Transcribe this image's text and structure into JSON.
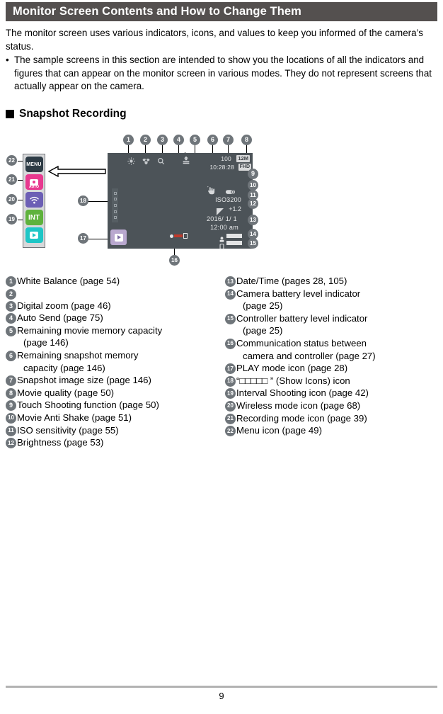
{
  "header": {
    "title": "Monitor Screen Contents and How to Change Them"
  },
  "intro": {
    "para1": "The monitor screen uses various indicators, icons, and values to keep you informed of the camera’s status.",
    "bullet_mark": "•",
    "bullet1": "The sample screens in this section are intended to show you the locations of all the indicators and figures that can appear on the monitor screen in various modes. They do not represent screens that actually appear on the camera."
  },
  "section": {
    "heading": "Snapshot Recording"
  },
  "monitor": {
    "remaining_snapshots": "100",
    "image_size_badge": "12M",
    "remaining_movie_time": "10:28:28",
    "movie_quality_badge": "FHD",
    "iso": "ISO3200",
    "brightness": "+1.2",
    "date": "2016/  1/  1",
    "clock": "12:00 am",
    "menu_label": "MENU",
    "rec_auto_label": "AUTO",
    "interval_label": "INT",
    "icons": {
      "white_balance": "sun-icon",
      "macro": "flower-icon",
      "digital_zoom": "magnifier-icon",
      "auto_send": "upload-icon",
      "touch_shooting": "hand-touch-icon",
      "movie_anti_shake": "anti-shake-icon",
      "brightness": "brightness-icon",
      "camera_battery": "camera-battery-icon",
      "controller_battery": "controller-battery-icon",
      "comm_status": "communication-status-icon",
      "play_mode": "play-mode-icon",
      "show_icons": "show-icons-strip-icon",
      "wireless": "wifi-icon"
    }
  },
  "callouts": {
    "c1": "1",
    "c2": "2",
    "c3": "3",
    "c4": "4",
    "c5": "5",
    "c6": "6",
    "c7": "7",
    "c8": "8",
    "c9": "9",
    "c10": "10",
    "c11": "11",
    "c12": "12",
    "c13": "13",
    "c14": "14",
    "c15": "15",
    "c16": "16",
    "c17": "17",
    "c18": "18",
    "c19": "19",
    "c20": "20",
    "c21": "21",
    "c22": "22"
  },
  "caption_left": [
    {
      "n": "1",
      "text": "White Balance (page 54)",
      "cont": ""
    },
    {
      "n": "2",
      "text": "",
      "cont": ""
    },
    {
      "n": "3",
      "text": "Digital zoom (page 46)",
      "cont": ""
    },
    {
      "n": "4",
      "text": "Auto Send (page 75)",
      "cont": ""
    },
    {
      "n": "5",
      "text": "Remaining movie memory capacity",
      "cont": "(page 146)"
    },
    {
      "n": "6",
      "text": "Remaining snapshot memory",
      "cont": "capacity (page 146)"
    },
    {
      "n": "7",
      "text": "Snapshot image size (page 146)",
      "cont": ""
    },
    {
      "n": "8",
      "text": "Movie quality (page 50)",
      "cont": ""
    },
    {
      "n": "9",
      "text": "Touch Shooting function (page 50)",
      "cont": ""
    },
    {
      "n": "10",
      "text": "Movie Anti Shake (page 51)",
      "cont": ""
    },
    {
      "n": "11",
      "text": "ISO sensitivity (page 55)",
      "cont": ""
    },
    {
      "n": "12",
      "text": "Brightness (page 53)",
      "cont": ""
    }
  ],
  "caption_right": [
    {
      "n": "13",
      "text": "Date/Time (pages 28, 105)",
      "cont": ""
    },
    {
      "n": "14",
      "text": "Camera battery level indicator",
      "cont": "(page 25)"
    },
    {
      "n": "15",
      "text": "Controller battery level indicator",
      "cont": "(page 25)"
    },
    {
      "n": "16",
      "text": "Communication status between",
      "cont": "camera and controller (page 27)"
    },
    {
      "n": "17",
      "text": "PLAY mode icon (page 28)",
      "cont": ""
    },
    {
      "n": "18",
      "text": "“□□□□□ ” (Show Icons) icon",
      "cont": ""
    },
    {
      "n": "19",
      "text": "Interval Shooting icon (page 42)",
      "cont": ""
    },
    {
      "n": "20",
      "text": "Wireless mode icon (page 68)",
      "cont": ""
    },
    {
      "n": "21",
      "text": "Recording mode icon (page 39)",
      "cont": ""
    },
    {
      "n": "22",
      "text": "Menu icon (page 49)",
      "cont": ""
    }
  ],
  "footer": {
    "page_number": "9"
  },
  "colors": {
    "header_bg": "#54504f",
    "monitor_bg": "#4c5358",
    "callout_bg": "#6f757a",
    "rec_pink": "#e8398f",
    "wifi_purple": "#6c5fb5",
    "int_green": "#5eb23c",
    "play_cyan": "#1ec6c6",
    "menu_dark": "#2d3b45",
    "play_lilac": "#b9a8cf"
  }
}
